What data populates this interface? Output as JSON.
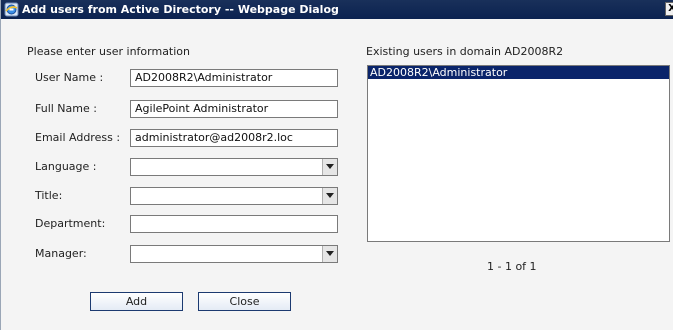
{
  "window": {
    "title": "Add users from Active Directory -- Webpage Dialog",
    "close_glyph": "X"
  },
  "left_panel": {
    "heading": "Please enter user information",
    "fields": {
      "user_name": {
        "label": "User Name :",
        "value": "AD2008R2\\Administrator"
      },
      "full_name": {
        "label": "Full Name :",
        "value": "AgilePoint Administrator"
      },
      "email": {
        "label": "Email Address :",
        "value": "administrator@ad2008r2.loc"
      },
      "language": {
        "label": "Language :",
        "value": ""
      },
      "title": {
        "label": "Title:",
        "value": ""
      },
      "department": {
        "label": "Department:",
        "value": ""
      },
      "manager": {
        "label": "Manager:",
        "value": ""
      }
    }
  },
  "right_panel": {
    "heading": "Existing users in domain AD2008R2",
    "users": [
      "AD2008R2\\Administrator"
    ],
    "pager_text": "1 - 1 of 1"
  },
  "buttons": {
    "add": "Add",
    "close": "Close"
  },
  "colors": {
    "titlebar": "#0b2250",
    "selection": "#0a246a",
    "dialog_background": "#f4f4f4"
  },
  "icons": {
    "title_icon": "ie-globe-icon",
    "dropdown": "chevron-down-icon"
  }
}
